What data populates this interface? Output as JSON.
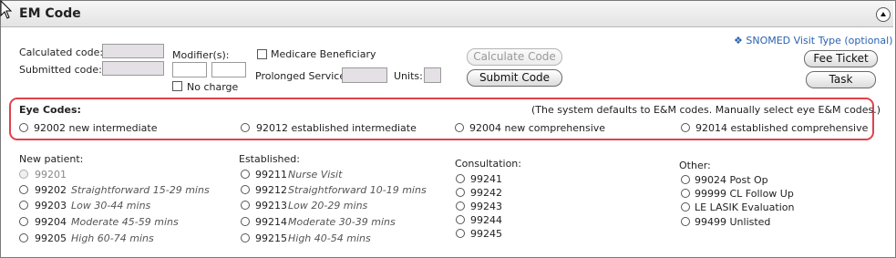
{
  "header": {
    "title": "EM Code"
  },
  "codes": {
    "calculated_label": "Calculated code:",
    "submitted_label": "Submitted code:",
    "modifiers_label": "Modifier(s):",
    "no_charge_label": "No charge",
    "medicare_label": "Medicare Beneficiary",
    "prolonged_label": "Prolonged Service:",
    "units_label": "Units:"
  },
  "buttons": {
    "calculate": "Calculate Code",
    "submit": "Submit Code",
    "fee_ticket": "Fee Ticket",
    "task": "Task"
  },
  "snomed_link": "❖ SNOMED Visit Type (optional)",
  "eye_codes": {
    "title": "Eye Codes:",
    "note": "(The system defaults to E&M codes.  Manually select eye E&M codes.)",
    "options": [
      "92002 new intermediate",
      "92012 established intermediate",
      "92004 new comprehensive",
      "92014 established comprehensive"
    ]
  },
  "new_patient": {
    "title": "New patient:",
    "items": [
      {
        "code": "99201",
        "desc": ""
      },
      {
        "code": "99202",
        "desc": "Straightforward 15-29 mins"
      },
      {
        "code": "99203",
        "desc": "Low 30-44 mins"
      },
      {
        "code": "99204",
        "desc": "Moderate 45-59 mins"
      },
      {
        "code": "99205",
        "desc": "High 60-74 mins"
      }
    ]
  },
  "established": {
    "title": "Established:",
    "items": [
      {
        "code": "99211",
        "desc": "Nurse Visit"
      },
      {
        "code": "99212",
        "desc": "Straightforward 10-19 mins"
      },
      {
        "code": "99213",
        "desc": "Low 20-29 mins"
      },
      {
        "code": "99214",
        "desc": "Moderate 30-39 mins"
      },
      {
        "code": "99215",
        "desc": "High 40-54 mins"
      }
    ]
  },
  "consultation": {
    "title": "Consultation:",
    "items": [
      "99241",
      "99242",
      "99243",
      "99244",
      "99245"
    ]
  },
  "other": {
    "title": "Other:",
    "items": [
      "99024 Post Op",
      "99999 CL Follow Up",
      "LE LASIK Evaluation",
      "99499 Unlisted"
    ]
  }
}
